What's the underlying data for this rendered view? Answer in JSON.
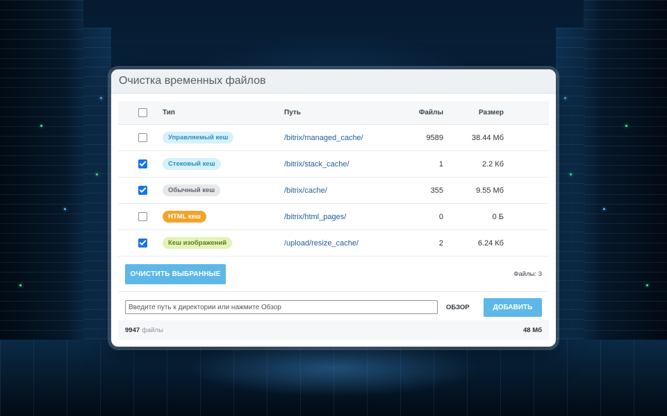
{
  "window": {
    "title": "Очистка временных файлов"
  },
  "table": {
    "columns": {
      "type": "Тип",
      "path": "Путь",
      "files": "Файлы",
      "size": "Размер"
    },
    "select_all_checked": false,
    "rows": [
      {
        "checked": false,
        "type": "Управляемый кеш",
        "badge_bg": "#d6f1fb",
        "badge_fg": "#2b8fc2",
        "path": "/bitrix/managed_cache/",
        "files": "9589",
        "size": "38.44 Мб"
      },
      {
        "checked": true,
        "type": "Стековый кеш",
        "badge_bg": "#d6f1fb",
        "badge_fg": "#2b8fc2",
        "path": "/bitrix/stack_cache/",
        "files": "1",
        "size": "2.2 Кб"
      },
      {
        "checked": true,
        "type": "Обычный кеш",
        "badge_bg": "#e6e8ea",
        "badge_fg": "#5a636c",
        "path": "/bitrix/cache/",
        "files": "355",
        "size": "9.55 Мб"
      },
      {
        "checked": false,
        "type": "HTML кеш",
        "badge_bg": "#f0a52a",
        "badge_fg": "#ffffff",
        "path": "/bitrix/html_pages/",
        "files": "0",
        "size": "0 Б"
      },
      {
        "checked": true,
        "type": "Кеш изображений",
        "badge_bg": "#e4f3b8",
        "badge_fg": "#5e7d16",
        "path": "/upload/resize_cache/",
        "files": "2",
        "size": "6.24 Кб"
      }
    ]
  },
  "actions": {
    "clear_label": "ОЧИСТИТЬ ВЫБРАННЫЕ",
    "files_count": "Файлы: 3"
  },
  "add_path": {
    "placeholder": "Введите путь к директории или нажмите Обзор",
    "value": "",
    "browse_label": "ОБЗОР",
    "add_label": "ДОБАВИТЬ"
  },
  "footer": {
    "total_files": "9947",
    "files_label": "файлы",
    "total_size": "48 Мб"
  },
  "colors": {
    "accent": "#5db8e8",
    "link": "#1e5c9e",
    "checkbox": "#1a73e8"
  }
}
